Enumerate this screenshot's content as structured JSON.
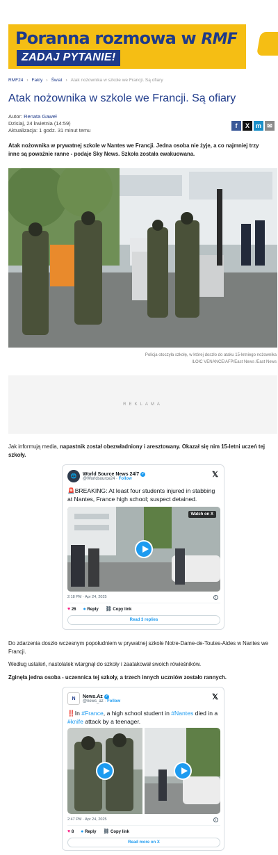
{
  "banner": {
    "title_main": "Poranna rozmowa w ",
    "title_brand": "RMF",
    "cta": "ZADAJ PYTANIE!"
  },
  "breadcrumb": [
    "RMF24",
    "Fakty",
    "Świat",
    "Atak nożownika w szkole we Francji. Są ofiary"
  ],
  "article": {
    "title": "Atak nożownika w szkole we Francji. Są ofiary",
    "author_label": "Autor:",
    "author_name": "Renata Gaweł",
    "date": "Dzisiaj, 24 kwietnia (14:59)",
    "updated": "Aktualizacja: 1 godz. 31 minut temu",
    "lead": "Atak nożownika w prywatnej szkole w Nantes we Francji. Jedna osoba nie żyje, a co najmniej trzy inne są poważnie ranne - podaje Sky News. Szkoła została ewakuowana.",
    "caption_line1": "Policja otoczyła szkołę, w której doszło do ataku 15-letniego nożownika",
    "caption_line2": "/LOIC VENANCE/AFP/East News /East News",
    "ad_label": "REKLAMA",
    "para1_normal": "Jak informują media, ",
    "para1_bold": "napastnik został obezwładniony i aresztowany. Okazał się nim 15-letni uczeń tej szkoły.",
    "para2": "Do zdarzenia doszło wczesnym popołudniem w prywatnej szkole Notre-Dame-de-Toutes-Aides w Nantes we Francji.",
    "para3": "Według ustaleń, nastolatek wtargnął do szkoły i zaatakował swoich rówieśników.",
    "para4": "Zginęła jedna osoba - uczennica tej szkoły, a trzech innych uczniów zostało rannych."
  },
  "share": {
    "facebook": "f",
    "x": "X",
    "messenger": "m",
    "mail": "✉"
  },
  "tweet1": {
    "name": "World Source News 24/7",
    "handle": "@Worldsource24",
    "follow": "Follow",
    "text": "🚨BREAKING: At least four students injured in stabbing at Nantes, France high school; suspect detained.",
    "watch": "Watch on X",
    "time": "2:18 PM · Apr 24, 2025",
    "likes": "26",
    "reply": "Reply",
    "copy": "Copy link",
    "button": "Read 3 replies"
  },
  "tweet2": {
    "name": "News.Az",
    "handle": "@news_az",
    "follow": "Follow",
    "text_prefix": "‼️In ",
    "hash1": "#France",
    "text_mid1": ", a high school student in ",
    "hash2": "#Nantes",
    "text_mid2": " died in a ",
    "hash3": "#knife",
    "text_end": " attack by a teenager.",
    "time": "2:47 PM · Apr 24, 2025",
    "likes": "8",
    "reply": "Reply",
    "copy": "Copy link",
    "button": "Read more on X"
  },
  "colors": {
    "brand_blue": "#1e3a8a",
    "banner_yellow": "#f5be14",
    "x_blue": "#1d9bf0",
    "like_pink": "#f91880"
  }
}
